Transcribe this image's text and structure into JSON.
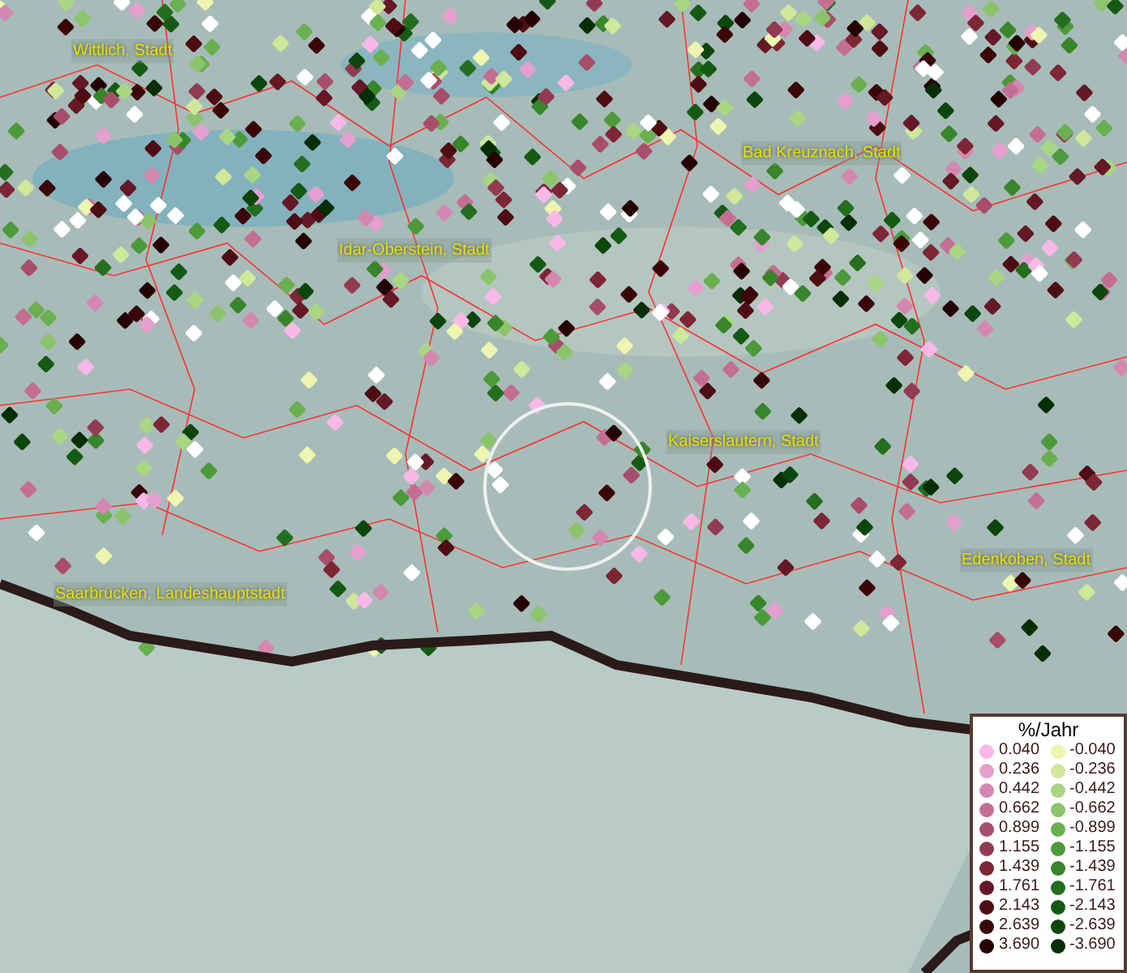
{
  "map": {
    "labels": [
      {
        "text": "Wittlich, Stadt"
      },
      {
        "text": "Bad Kreuznach, Stadt"
      },
      {
        "text": "Idar-Oberstein, Stadt"
      },
      {
        "text": "Kaiserslautern, Stadt"
      },
      {
        "text": "Edenkoben, Stadt"
      },
      {
        "text": "Saarbrücken, Landeshauptstadt"
      }
    ]
  },
  "legend": {
    "title": "%/Jahr",
    "classes": [
      {
        "value": "0.040",
        "color": "#f9b8e8"
      },
      {
        "value": "-0.040",
        "color": "#eef5b0"
      },
      {
        "value": "0.236",
        "color": "#e59fcf"
      },
      {
        "value": "-0.236",
        "color": "#cfe89a"
      },
      {
        "value": "0.442",
        "color": "#d488b0"
      },
      {
        "value": "-0.442",
        "color": "#a9d682"
      },
      {
        "value": "0.662",
        "color": "#c46e93"
      },
      {
        "value": "-0.662",
        "color": "#8bc46a"
      },
      {
        "value": "0.899",
        "color": "#a84d6a"
      },
      {
        "value": "-0.899",
        "color": "#6aaf50"
      },
      {
        "value": "1.155",
        "color": "#923a52"
      },
      {
        "value": "-1.155",
        "color": "#4c9a3a"
      },
      {
        "value": "1.439",
        "color": "#7d2636"
      },
      {
        "value": "-1.439",
        "color": "#38852b"
      },
      {
        "value": "1.761",
        "color": "#651825"
      },
      {
        "value": "-1.761",
        "color": "#246e1f"
      },
      {
        "value": "2.143",
        "color": "#4e0c14"
      },
      {
        "value": "-2.143",
        "color": "#155a14"
      },
      {
        "value": "2.639",
        "color": "#3a0509"
      },
      {
        "value": "-2.639",
        "color": "#0c460c"
      },
      {
        "value": "3.690",
        "color": "#250003"
      },
      {
        "value": "-3.690",
        "color": "#052e05"
      }
    ]
  }
}
